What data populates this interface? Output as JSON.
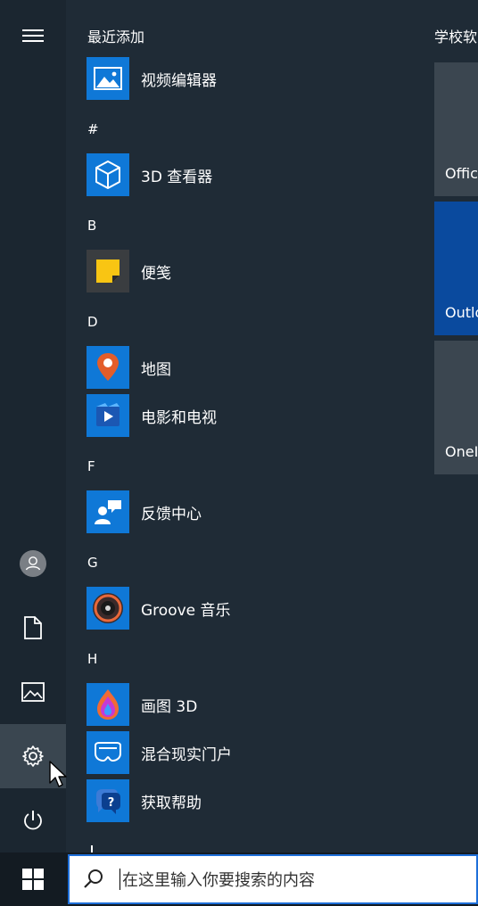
{
  "list": {
    "recent_title": "最近添加",
    "letters": [
      "#",
      "B",
      "D",
      "F",
      "G",
      "H"
    ],
    "apps": [
      {
        "label": "视频编辑器",
        "icon": "photos-video-editor-icon"
      },
      {
        "label": "3D 查看器",
        "icon": "3d-viewer-cube-icon"
      },
      {
        "label": "便笺",
        "icon": "sticky-notes-icon"
      },
      {
        "label": "地图",
        "icon": "maps-pin-icon"
      },
      {
        "label": "电影和电视",
        "icon": "movies-tv-icon"
      },
      {
        "label": "反馈中心",
        "icon": "feedback-hub-icon"
      },
      {
        "label": "Groove 音乐",
        "icon": "groove-music-icon"
      },
      {
        "label": "画图 3D",
        "icon": "paint-3d-icon"
      },
      {
        "label": "混合现实门户",
        "icon": "mixed-reality-icon"
      },
      {
        "label": "获取帮助",
        "icon": "get-help-icon"
      }
    ]
  },
  "tiles": {
    "group_title": "学校软",
    "items": [
      {
        "label": "Offic",
        "color": "#3b4650"
      },
      {
        "label": "Outlo",
        "color": "#0a4a9e"
      },
      {
        "label": "OneI",
        "color": "#3b4650"
      }
    ]
  },
  "rail": {
    "icons": [
      "hamburger-menu-icon",
      "user-avatar-icon",
      "documents-icon",
      "pictures-icon",
      "settings-gear-icon",
      "power-icon"
    ]
  },
  "taskbar": {
    "search_placeholder": "在这里输入你要搜索的内容",
    "start_icon": "windows-logo-icon",
    "search_icon": "search-icon"
  },
  "colors": {
    "accent": "#0f78d7",
    "menu_bg": "#1f2b36",
    "rail_bg": "#1b2630",
    "taskbar_bg": "#131b22"
  }
}
